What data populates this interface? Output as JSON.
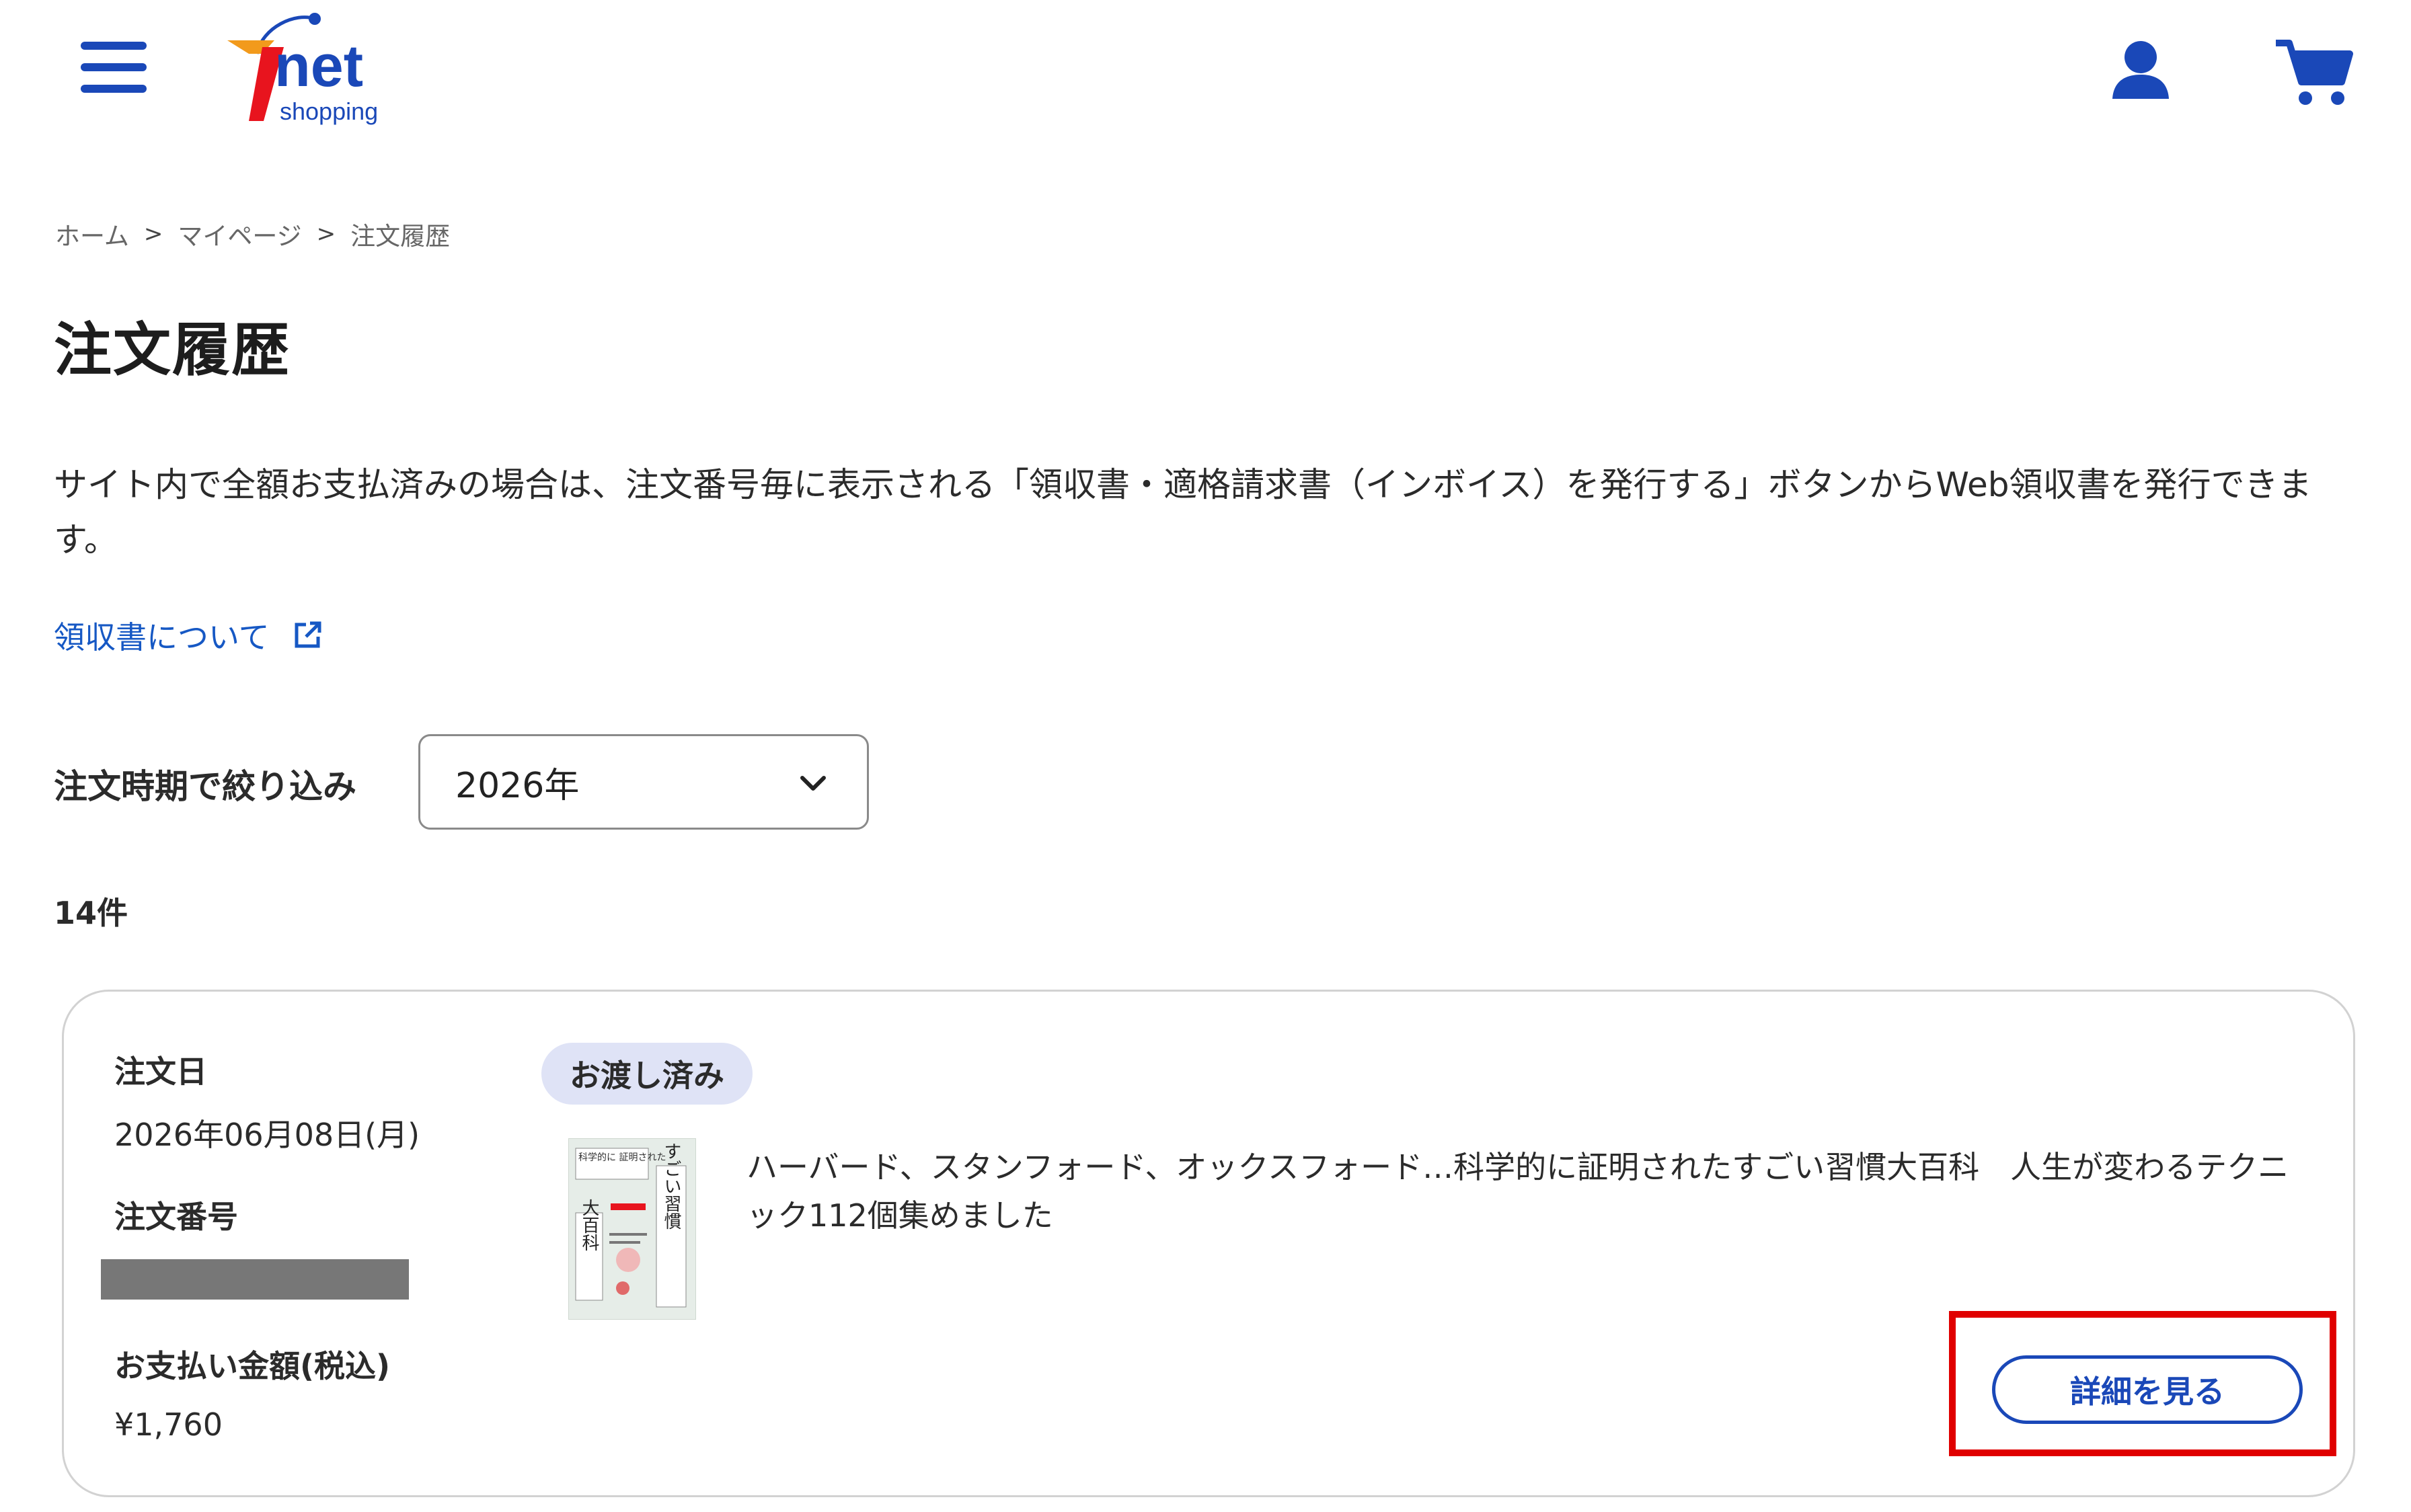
{
  "header": {
    "logo_main": "7net",
    "logo_sub": "shopping",
    "menu_icon": "hamburger-menu-icon",
    "user_icon": "user-account-icon",
    "cart_icon": "shopping-cart-icon"
  },
  "breadcrumb": {
    "items": [
      "ホーム",
      "マイページ",
      "注文履歴"
    ],
    "separator": ">"
  },
  "page": {
    "title": "注文履歴",
    "notice": "サイト内で全額お支払済みの場合は、注文番号毎に表示される「領収書・適格請求書（インボイス）を発行する」ボタンからWeb領収書を発行できます。",
    "receipt_link": "領収書について",
    "filter_label": "注文時期で絞り込み",
    "filter_value": "2026年",
    "count": "14件"
  },
  "order": {
    "date_label": "注文日",
    "date": "2026年06月08日(月)",
    "number_label": "注文番号",
    "payment_label": "お支払い金額(税込)",
    "payment_amount": "¥1,760",
    "status": "お渡し済み",
    "product_title": "ハーバード、スタンフォード、オックスフォード…科学的に証明されたすごい習慣大百科　人生が変わるテクニック112個集めました",
    "cover_text_top": "科学的に 証明された",
    "cover_text_side": "すごい習慣",
    "cover_text_main": "大百科",
    "detail_button": "詳細を見る"
  },
  "colors": {
    "brand_blue": "#1a48b8",
    "link_blue": "#1658c4",
    "badge_bg": "#dfe3f6",
    "highlight_red": "#e00000",
    "logo_red": "#e8141e",
    "logo_orange": "#f29a1c"
  }
}
